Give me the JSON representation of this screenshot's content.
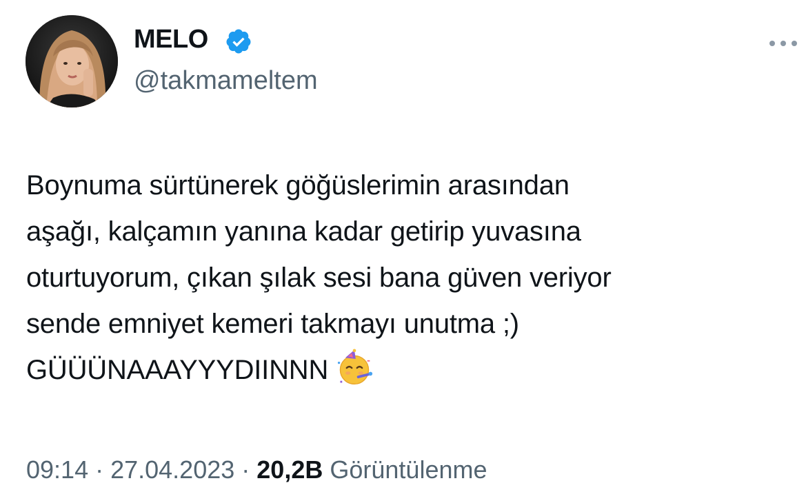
{
  "user": {
    "display_name": "MELO",
    "handle": "@takmameltem",
    "verified": true,
    "avatar_icon": "profile-photo"
  },
  "menu_icon": "more-options-icon",
  "tweet": {
    "lines": [
      "Boynuma sürtünerek göğüslerimin arasından",
      "aşağı, kalçamın yanına kadar getirip yuvasına",
      "oturtuyorum, çıkan şılak sesi bana güven veriyor",
      "sende emniyet kemeri takmayı unutma ;)",
      "GÜÜÜNAAAYYYDIINNN"
    ],
    "emoji": "partying-face-emoji"
  },
  "meta": {
    "time": "09:14",
    "separator": " · ",
    "date": "27.04.2023",
    "views_count": "20,2B",
    "views_label": "Görüntülenme"
  },
  "colors": {
    "text": "#0f1419",
    "secondary": "#536471",
    "verified": "#1d9bf0",
    "background": "#ffffff"
  }
}
